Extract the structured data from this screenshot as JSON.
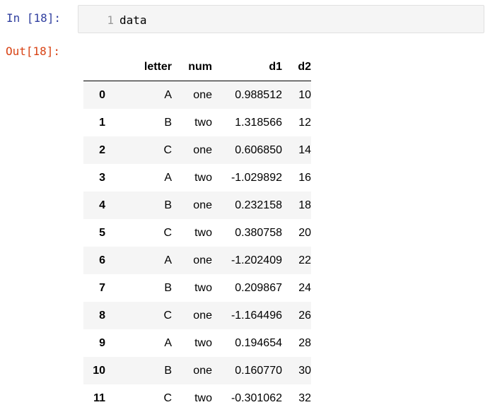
{
  "cell": {
    "in_prompt": "In [18]:",
    "out_prompt": "Out[18]:",
    "line_number": "1",
    "code": "data"
  },
  "dataframe": {
    "index_header": "",
    "columns": [
      "letter",
      "num",
      "d1",
      "d2"
    ],
    "rows": [
      {
        "index": "0",
        "cells": [
          "A",
          "one",
          "0.988512",
          "10"
        ]
      },
      {
        "index": "1",
        "cells": [
          "B",
          "two",
          "1.318566",
          "12"
        ]
      },
      {
        "index": "2",
        "cells": [
          "C",
          "one",
          "0.606850",
          "14"
        ]
      },
      {
        "index": "3",
        "cells": [
          "A",
          "two",
          "-1.029892",
          "16"
        ]
      },
      {
        "index": "4",
        "cells": [
          "B",
          "one",
          "0.232158",
          "18"
        ]
      },
      {
        "index": "5",
        "cells": [
          "C",
          "two",
          "0.380758",
          "20"
        ]
      },
      {
        "index": "6",
        "cells": [
          "A",
          "one",
          "-1.202409",
          "22"
        ]
      },
      {
        "index": "7",
        "cells": [
          "B",
          "two",
          "0.209867",
          "24"
        ]
      },
      {
        "index": "8",
        "cells": [
          "C",
          "one",
          "-1.164496",
          "26"
        ]
      },
      {
        "index": "9",
        "cells": [
          "A",
          "two",
          "0.194654",
          "28"
        ]
      },
      {
        "index": "10",
        "cells": [
          "B",
          "one",
          "0.160770",
          "30"
        ]
      },
      {
        "index": "11",
        "cells": [
          "C",
          "two",
          "-0.301062",
          "32"
        ]
      }
    ]
  },
  "colors": {
    "in_prompt": "#303F9F",
    "out_prompt": "#D84315",
    "input_background": "#f5f5f5",
    "stripe": "#f5f5f5"
  }
}
